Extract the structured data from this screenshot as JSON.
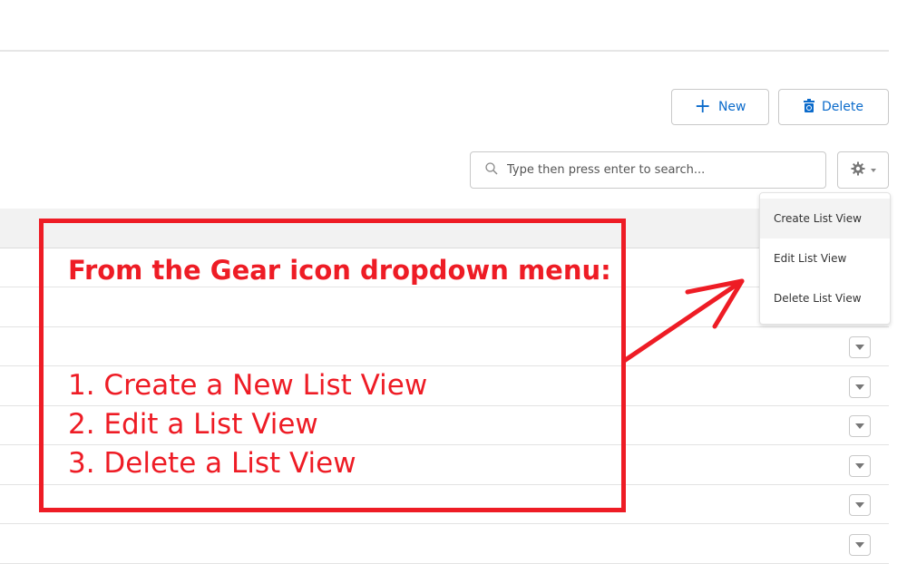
{
  "toolbar": {
    "new_label": "New",
    "delete_label": "Delete",
    "new_icon": "plus-icon",
    "delete_icon": "trash-icon"
  },
  "search": {
    "placeholder": "Type then press enter to search...",
    "value": "",
    "icon": "search-icon"
  },
  "settings": {
    "icon": "gear-icon",
    "caret_icon": "caret-down-icon"
  },
  "gear_menu": {
    "items": [
      {
        "label": "Create List View",
        "highlighted": true
      },
      {
        "label": "Edit List View",
        "highlighted": false
      },
      {
        "label": "Delete List View",
        "highlighted": false
      }
    ]
  },
  "table": {
    "row_count_visible": 8,
    "row_action_icon": "caret-down-icon"
  },
  "annotation": {
    "title": "From the Gear icon dropdown menu:",
    "steps": [
      "1. Create a New List View",
      "2. Edit a List View",
      "3. Delete a List View"
    ],
    "color": "#ee1c25"
  },
  "colors": {
    "accent": "#0b6bcb",
    "border": "#c9c9c9",
    "header_bg": "#f2f2f2"
  }
}
